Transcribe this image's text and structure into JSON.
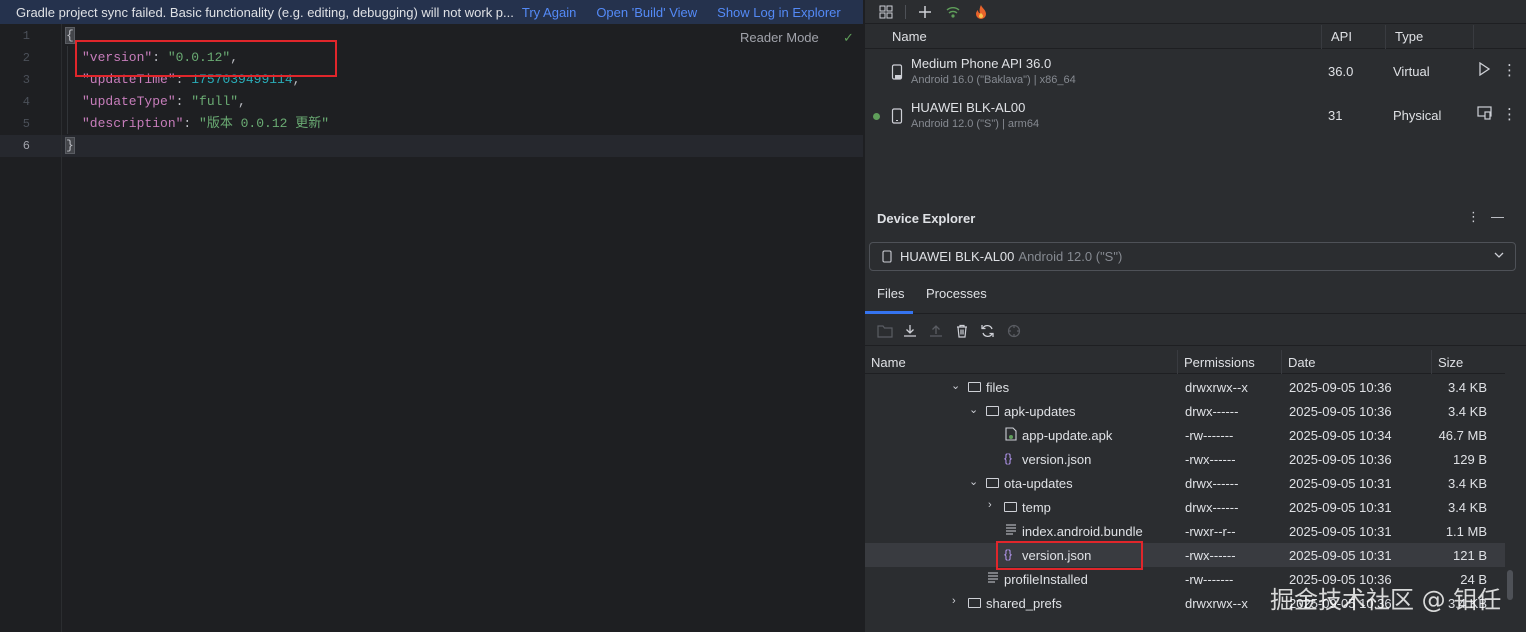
{
  "banner": {
    "message": "Gradle project sync failed. Basic functionality (e.g. editing, debugging) will not work p...",
    "try_again": "Try Again",
    "open_build": "Open 'Build' View",
    "show_log": "Show Log in Explorer"
  },
  "editor": {
    "reader_mode": "Reader Mode",
    "line_numbers": [
      "1",
      "2",
      "3",
      "4",
      "5",
      "6"
    ],
    "lines": {
      "l1": "{",
      "l2_key": "\"version\"",
      "l2_val": "\"0.0.12\"",
      "l3_key": "\"updateTime\"",
      "l3_val": "1757039499114",
      "l4_key": "\"updateType\"",
      "l4_val": "\"full\"",
      "l5_key": "\"description\"",
      "l5_val": "\"版本 0.0.12 更新\"",
      "l6": "}"
    },
    "colon": ": ",
    "comma": ","
  },
  "devices": {
    "headers": {
      "name": "Name",
      "api": "API",
      "type": "Type"
    },
    "rows": [
      {
        "name": "Medium Phone API 36.0",
        "sub": "Android 16.0 (\"Baklava\") | x86_64",
        "api": "36.0",
        "type": "Virtual"
      },
      {
        "name": "HUAWEI BLK-AL00",
        "sub": "Android 12.0 (\"S\") | arm64",
        "api": "31",
        "type": "Physical"
      }
    ]
  },
  "explorer": {
    "title": "Device Explorer",
    "device_selected": "HUAWEI BLK-AL00",
    "device_selected_sub": "Android 12.0 (\"S\")",
    "tabs": [
      "Files",
      "Processes"
    ],
    "headers": {
      "name": "Name",
      "permissions": "Permissions",
      "date": "Date",
      "size": "Size"
    },
    "rows": [
      {
        "name": "files",
        "perm": "drwxrwx--x",
        "date": "2025-09-05 10:36",
        "size": "3.4 KB"
      },
      {
        "name": "apk-updates",
        "perm": "drwx------",
        "date": "2025-09-05 10:36",
        "size": "3.4 KB"
      },
      {
        "name": "app-update.apk",
        "perm": "-rw-------",
        "date": "2025-09-05 10:34",
        "size": "46.7 MB"
      },
      {
        "name": "version.json",
        "perm": "-rwx------",
        "date": "2025-09-05 10:36",
        "size": "129 B"
      },
      {
        "name": "ota-updates",
        "perm": "drwx------",
        "date": "2025-09-05 10:31",
        "size": "3.4 KB"
      },
      {
        "name": "temp",
        "perm": "drwx------",
        "date": "2025-09-05 10:31",
        "size": "3.4 KB"
      },
      {
        "name": "index.android.bundle",
        "perm": "-rwxr--r--",
        "date": "2025-09-05 10:31",
        "size": "1.1 MB"
      },
      {
        "name": "version.json",
        "perm": "-rwx------",
        "date": "2025-09-05 10:31",
        "size": "121 B"
      },
      {
        "name": "profileInstalled",
        "perm": "-rw-------",
        "date": "2025-09-05 10:36",
        "size": "24 B"
      },
      {
        "name": "shared_prefs",
        "perm": "drwxrwx--x",
        "date": "2025-09-05 10:36",
        "size": "3.4 KB"
      }
    ]
  },
  "watermark": "掘金技术社区 @ 钼任"
}
